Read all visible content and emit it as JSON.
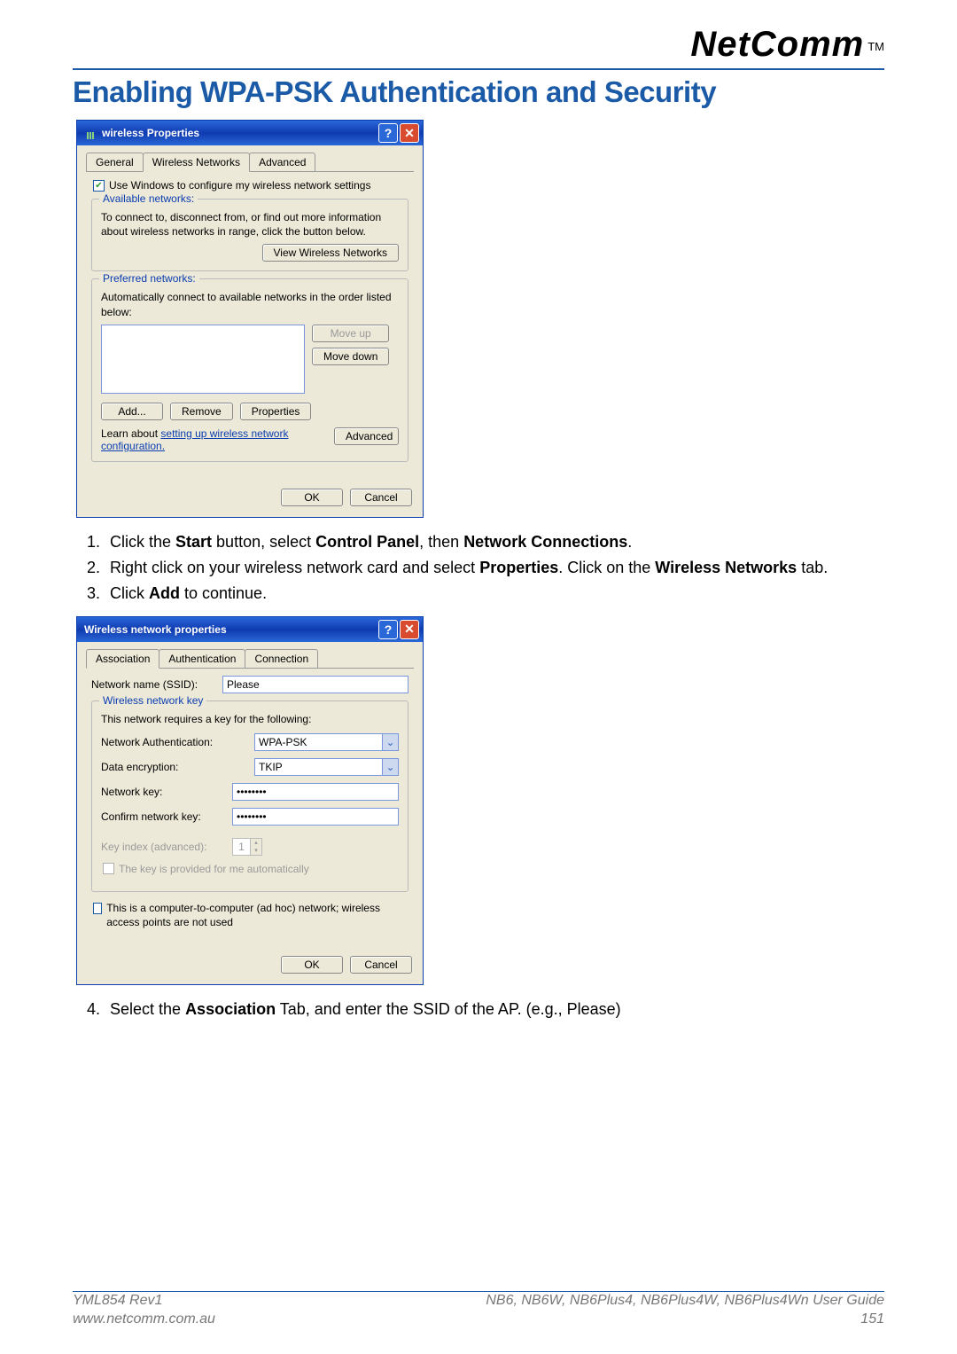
{
  "brand": "NetComm",
  "tm": "TM",
  "page_title": "Enabling WPA-PSK Authentication and Security",
  "dialog1": {
    "title": "wireless Properties",
    "tabs": [
      "General",
      "Wireless Networks",
      "Advanced"
    ],
    "chk_use_windows": "Use Windows to configure my wireless network settings",
    "available": {
      "legend": "Available networks:",
      "text": "To connect to, disconnect from, or find out more information about wireless networks in range, click the button below.",
      "view_btn": "View Wireless Networks"
    },
    "preferred": {
      "legend": "Preferred networks:",
      "text": "Automatically connect to available networks in the order listed below:",
      "move_up": "Move up",
      "move_down": "Move down",
      "add": "Add...",
      "remove": "Remove",
      "properties": "Properties"
    },
    "learn_prefix": "Learn about ",
    "learn_link": "setting up wireless network configuration.",
    "advanced": "Advanced",
    "ok": "OK",
    "cancel": "Cancel"
  },
  "instructions1": {
    "i1a": "Click the ",
    "i1b": "Start",
    "i1c": " button, select ",
    "i1d": "Control Panel",
    "i1e": ", then ",
    "i1f": "Network Connections",
    "i1g": ".",
    "i2a": "Right click on your wireless network card and select ",
    "i2b": "Properties",
    "i2c": ". Click on the ",
    "i2d": "Wireless Networks",
    "i2e": " tab.",
    "i3a": "Click ",
    "i3b": "Add",
    "i3c": " to continue."
  },
  "dialog2": {
    "title": "Wireless network properties",
    "tabs": [
      "Association",
      "Authentication",
      "Connection"
    ],
    "ssid_label": "Network name (SSID):",
    "ssid_value": "Please",
    "key_group": {
      "legend": "Wireless network key",
      "requires": "This network requires a key for the following:",
      "net_auth_label": "Network Authentication:",
      "net_auth_value": "WPA-PSK",
      "data_enc_label": "Data encryption:",
      "data_enc_value": "TKIP",
      "net_key_label": "Network key:",
      "net_key_value": "••••••••",
      "confirm_label": "Confirm network key:",
      "confirm_value": "••••••••",
      "key_index_label": "Key index (advanced):",
      "key_index_value": "1",
      "auto_key_label": "The key is provided for me automatically"
    },
    "adhoc": "This is a computer-to-computer (ad hoc) network; wireless access points are not used",
    "ok": "OK",
    "cancel": "Cancel"
  },
  "instructions2": {
    "i4a": "Select the ",
    "i4b": "Association",
    "i4c": " Tab, and enter the SSID of the AP. (e.g., Please)"
  },
  "footer": {
    "rev": "YML854 Rev1",
    "url": "www.netcomm.com.au",
    "guide": "NB6, NB6W, NB6Plus4, NB6Plus4W, NB6Plus4Wn User Guide",
    "page": "151"
  }
}
